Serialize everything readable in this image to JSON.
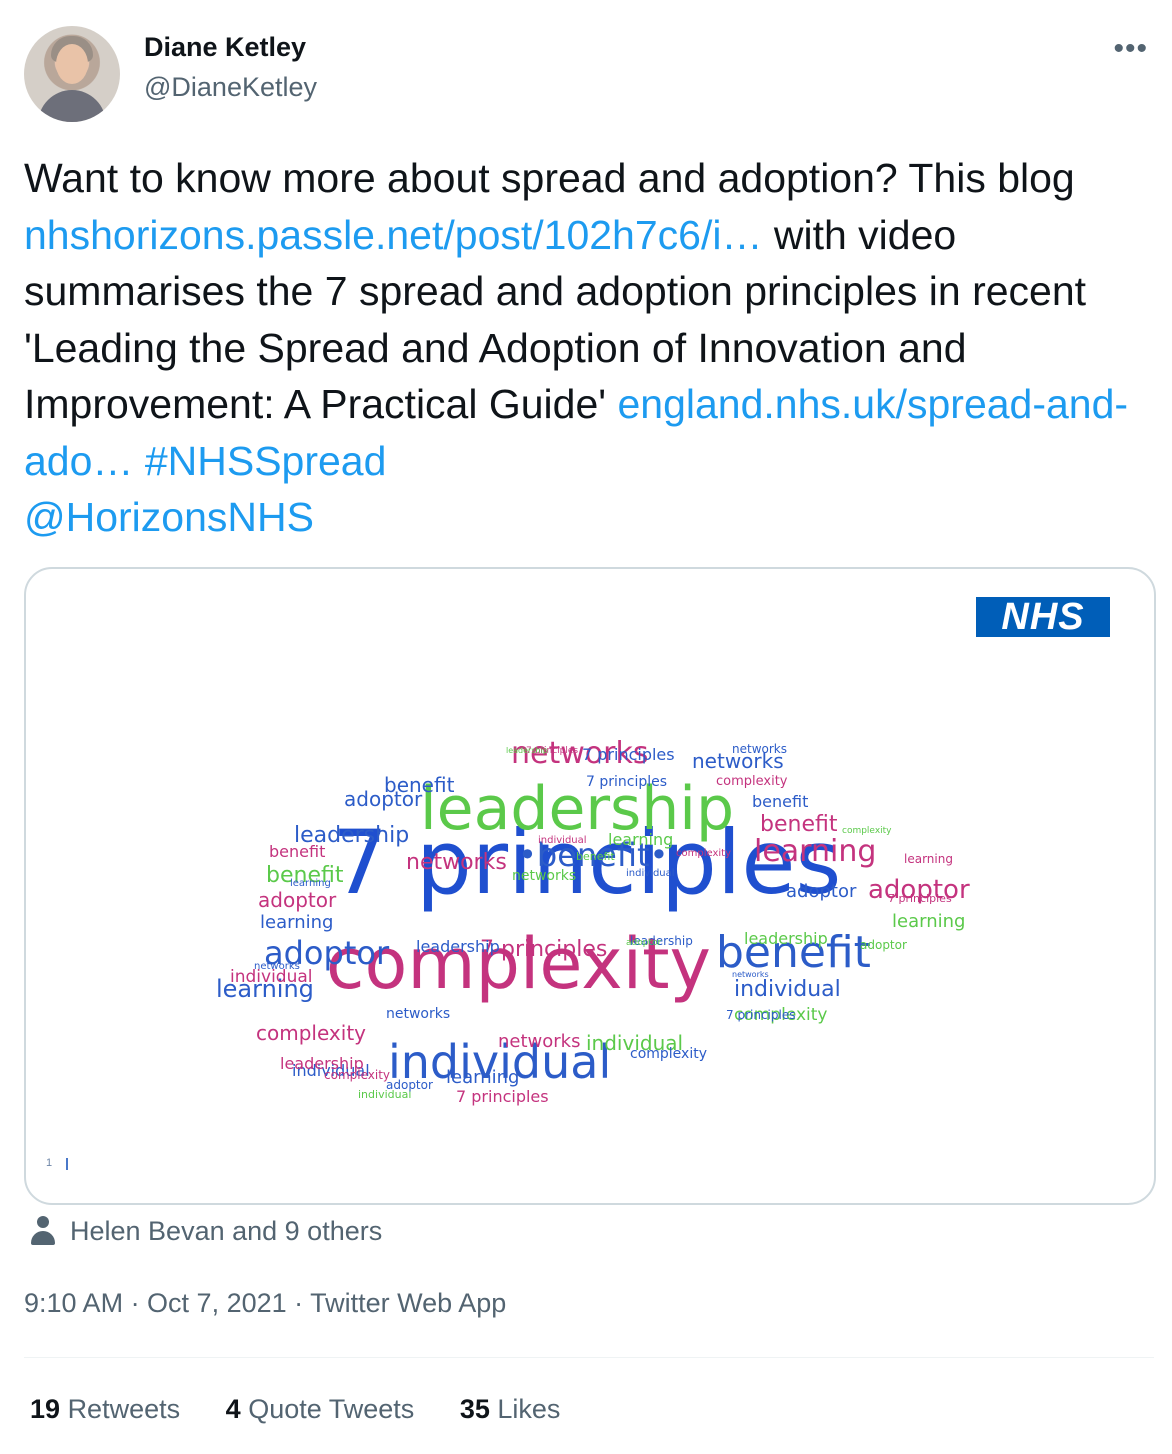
{
  "author": {
    "name": "Diane Ketley",
    "handle": "@DianeKetley"
  },
  "menu_glyph": "•••",
  "tweet": {
    "p1": "Want to know more about spread and adoption? This blog ",
    "link1": "nhshorizons.passle.net/post/102h7c6/i…",
    "p2": " with video summarises the 7 spread and adoption principles in recent 'Leading the Spread and Adoption of Innovation and Improvement: A Practical Guide' ",
    "link2": "england.nhs.uk/spread-and-ado…",
    "hashtag": "#NHSSpread",
    "mention": "@HorizonsNHS"
  },
  "card": {
    "logo": "NHS",
    "page_number": "1",
    "words": [
      {
        "t": "7 principles",
        "c": "#1f4fcf",
        "s": 88
      },
      {
        "t": "complexity",
        "c": "#c4337e",
        "s": 70
      },
      {
        "t": "leadership",
        "c": "#5bc94a",
        "s": 60
      },
      {
        "t": "individual",
        "c": "#2c5cc8",
        "s": 46
      },
      {
        "t": "benefit",
        "c": "#2c5cc8",
        "s": 44
      },
      {
        "t": "networks",
        "c": "#c4337e",
        "s": 30
      },
      {
        "t": "•benefit•",
        "c": "#2c5cc8",
        "s": 32
      },
      {
        "t": "learning",
        "c": "#c4337e",
        "s": 30
      },
      {
        "t": "adoptor",
        "c": "#2c5cc8",
        "s": 32
      },
      {
        "t": "adoptor",
        "c": "#c4337e",
        "s": 26
      },
      {
        "t": "learning",
        "c": "#2c5cc8",
        "s": 24
      },
      {
        "t": "leadership",
        "c": "#2c5cc8",
        "s": 22
      },
      {
        "t": "networks",
        "c": "#c4337e",
        "s": 22
      },
      {
        "t": "networks",
        "c": "#2c5cc8",
        "s": 20
      },
      {
        "t": "benefit",
        "c": "#2c5cc8",
        "s": 20
      },
      {
        "t": "adoptor",
        "c": "#2c5cc8",
        "s": 20
      },
      {
        "t": "benefit",
        "c": "#c4337e",
        "s": 22
      },
      {
        "t": "adoptor",
        "c": "#2c5cc8",
        "s": 18
      },
      {
        "t": "benefit",
        "c": "#5bc94a",
        "s": 22
      },
      {
        "t": "adoptor",
        "c": "#c4337e",
        "s": 20
      },
      {
        "t": "learning",
        "c": "#2c5cc8",
        "s": 18
      },
      {
        "t": "learning",
        "c": "#5bc94a",
        "s": 18
      },
      {
        "t": "7 principles",
        "c": "#c4337e",
        "s": 22
      },
      {
        "t": "individual",
        "c": "#c4337e",
        "s": 17
      },
      {
        "t": "individual",
        "c": "#2c5cc8",
        "s": 22
      },
      {
        "t": "complexity",
        "c": "#5bc94a",
        "s": 17
      },
      {
        "t": "complexity",
        "c": "#c4337e",
        "s": 20
      },
      {
        "t": "networks",
        "c": "#c4337e",
        "s": 18
      },
      {
        "t": "individual",
        "c": "#5bc94a",
        "s": 20
      },
      {
        "t": "individual",
        "c": "#2c5cc8",
        "s": 16
      },
      {
        "t": "leadership",
        "c": "#c4337e",
        "s": 16
      },
      {
        "t": "leadership",
        "c": "#2c5cc8",
        "s": 16
      },
      {
        "t": "leadership",
        "c": "#5bc94a",
        "s": 16
      },
      {
        "t": "learning",
        "c": "#2c5cc8",
        "s": 18
      },
      {
        "t": "learning",
        "c": "#5bc94a",
        "s": 16
      },
      {
        "t": "benefit",
        "c": "#c4337e",
        "s": 16
      },
      {
        "t": "7 principles",
        "c": "#2c5cc8",
        "s": 14
      },
      {
        "t": "complexity",
        "c": "#c4337e",
        "s": 13
      },
      {
        "t": "networks",
        "c": "#2c5cc8",
        "s": 14
      },
      {
        "t": "complexity",
        "c": "#2c5cc8",
        "s": 14
      },
      {
        "t": "7 principles",
        "c": "#2c5cc8",
        "s": 16
      },
      {
        "t": "benefit",
        "c": "#2c5cc8",
        "s": 16
      },
      {
        "t": "7 principles",
        "c": "#c4337e",
        "s": 16
      },
      {
        "t": "networks",
        "c": "#5bc94a",
        "s": 14
      },
      {
        "t": "learning",
        "c": "#c4337e",
        "s": 12
      },
      {
        "t": "individual",
        "c": "#5bc94a",
        "s": 11
      },
      {
        "t": "complexity",
        "c": "#5bc94a",
        "s": 9
      },
      {
        "t": "7 principles",
        "c": "#c4337e",
        "s": 11
      },
      {
        "t": "7 principles",
        "c": "#2c5cc8",
        "s": 12
      },
      {
        "t": "adoptor",
        "c": "#5bc94a",
        "s": 12
      },
      {
        "t": "networks",
        "c": "#2c5cc8",
        "s": 12
      },
      {
        "t": "individual",
        "c": "#c4337e",
        "s": 10
      },
      {
        "t": "complexity",
        "c": "#c4337e",
        "s": 12
      },
      {
        "t": "benefit",
        "c": "#5bc94a",
        "s": 11
      },
      {
        "t": "leadership",
        "c": "#2c5cc8",
        "s": 12
      },
      {
        "t": "adoptor",
        "c": "#2c5cc8",
        "s": 12
      },
      {
        "t": "learning",
        "c": "#2c5cc8",
        "s": 10
      },
      {
        "t": "networks",
        "c": "#2c5cc8",
        "s": 10
      },
      {
        "t": "individual",
        "c": "#2c5cc8",
        "s": 10
      },
      {
        "t": "complexity",
        "c": "#c4337e",
        "s": 10
      },
      {
        "t": "adoptor",
        "c": "#5bc94a",
        "s": 9
      },
      {
        "t": "7 principles",
        "c": "#c4337e",
        "s": 9
      },
      {
        "t": "leadership",
        "c": "#5bc94a",
        "s": 8
      },
      {
        "t": "networks",
        "c": "#2c5cc8",
        "s": 8
      }
    ]
  },
  "social_context": "Helen Bevan and 9 others",
  "timestamp": "9:10 AM · Oct 7, 2021 · Twitter Web App",
  "stats": [
    {
      "count": "19",
      "label": "Retweets"
    },
    {
      "count": "4",
      "label": "Quote Tweets"
    },
    {
      "count": "35",
      "label": "Likes"
    }
  ]
}
